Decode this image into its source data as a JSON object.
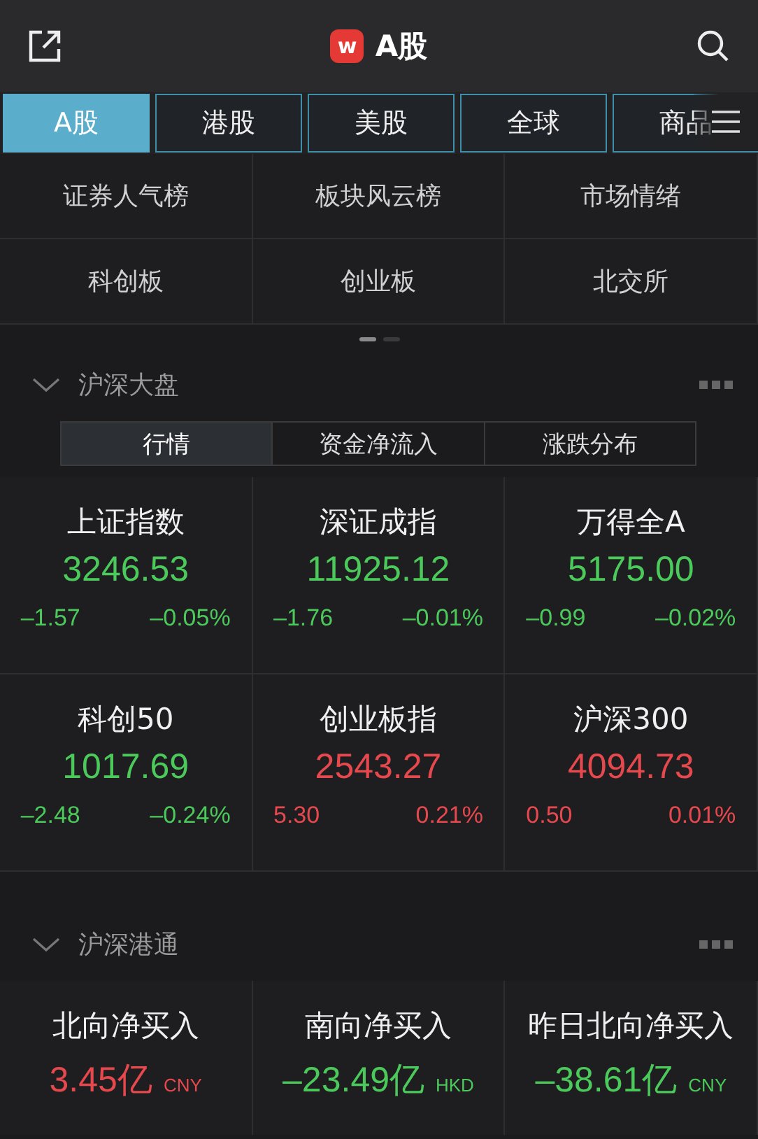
{
  "header": {
    "logo": "w",
    "title": "A股"
  },
  "tabs": [
    {
      "label": "A股",
      "selected": true
    },
    {
      "label": "港股",
      "selected": false
    },
    {
      "label": "美股",
      "selected": false
    },
    {
      "label": "全球",
      "selected": false
    },
    {
      "label": "商品",
      "selected": false
    }
  ],
  "shortcuts": [
    "证券人气榜",
    "板块风云榜",
    "市场情绪",
    "科创板",
    "创业板",
    "北交所"
  ],
  "page_dots": [
    {
      "selected": true
    },
    {
      "selected": false
    }
  ],
  "market": {
    "title": "沪深大盘",
    "segments": [
      {
        "label": "行情",
        "selected": true
      },
      {
        "label": "资金净流入",
        "selected": false
      },
      {
        "label": "涨跌分布",
        "selected": false
      }
    ],
    "indices": [
      {
        "name": "上证指数",
        "value": "3246.53",
        "change": "–1.57",
        "pct": "–0.05%",
        "color": "#4cc95b"
      },
      {
        "name": "深证成指",
        "value": "11925.12",
        "change": "–1.76",
        "pct": "–0.01%",
        "color": "#4cc95b"
      },
      {
        "name": "万得全A",
        "value": "5175.00",
        "change": "–0.99",
        "pct": "–0.02%",
        "color": "#4cc95b"
      },
      {
        "name": "科创50",
        "value": "1017.69",
        "change": "–2.48",
        "pct": "–0.24%",
        "color": "#4cc95b"
      },
      {
        "name": "创业板指",
        "value": "2543.27",
        "change": "5.30",
        "pct": "0.21%",
        "color": "#e5484d"
      },
      {
        "name": "沪深300",
        "value": "4094.73",
        "change": "0.50",
        "pct": "0.01%",
        "color": "#e5484d"
      }
    ]
  },
  "connect": {
    "title": "沪深港通",
    "flows": [
      {
        "name": "北向净买入",
        "value": "3.45亿",
        "currency": "CNY",
        "color": "#e5484d"
      },
      {
        "name": "南向净买入",
        "value": "–23.49亿",
        "currency": "HKD",
        "color": "#4cc95b"
      },
      {
        "name": "昨日北向净买入",
        "value": "–38.61亿",
        "currency": "CNY",
        "color": "#4cc95b"
      }
    ]
  }
}
